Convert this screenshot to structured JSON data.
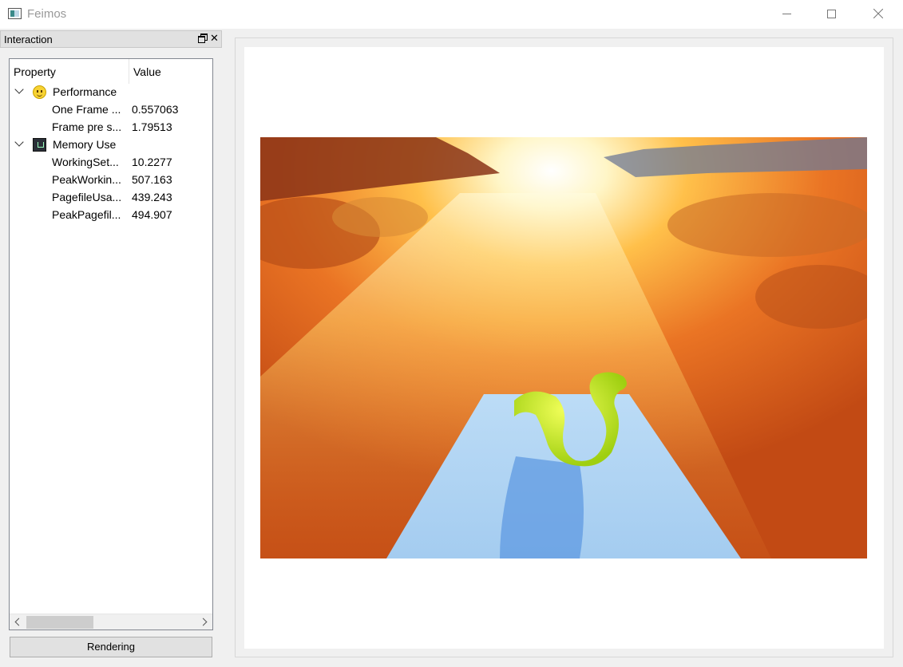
{
  "window": {
    "title": "Feimos",
    "controls": [
      "minimize",
      "maximize",
      "close"
    ]
  },
  "dock": {
    "title": "Interaction"
  },
  "tree": {
    "headers": {
      "property": "Property",
      "value": "Value"
    },
    "groups": [
      {
        "label": "Performance",
        "icon": "smiley-icon",
        "items": [
          {
            "property": "One Frame ...",
            "value": "0.557063"
          },
          {
            "property": "Frame pre s...",
            "value": "1.79513"
          }
        ]
      },
      {
        "label": "Memory Use",
        "icon": "memory-chip-icon",
        "items": [
          {
            "property": "WorkingSet...",
            "value": "10.2277"
          },
          {
            "property": "PeakWorkin...",
            "value": "507.163"
          },
          {
            "property": "PagefileUsa...",
            "value": "439.243"
          },
          {
            "property": "PeakPagefil...",
            "value": "494.907"
          }
        ]
      }
    ]
  },
  "buttons": {
    "rendering": "Rendering"
  },
  "colors": {
    "desert": "#d5581c",
    "plane": "#a9cdf0",
    "dragon": "#c4e81a"
  }
}
